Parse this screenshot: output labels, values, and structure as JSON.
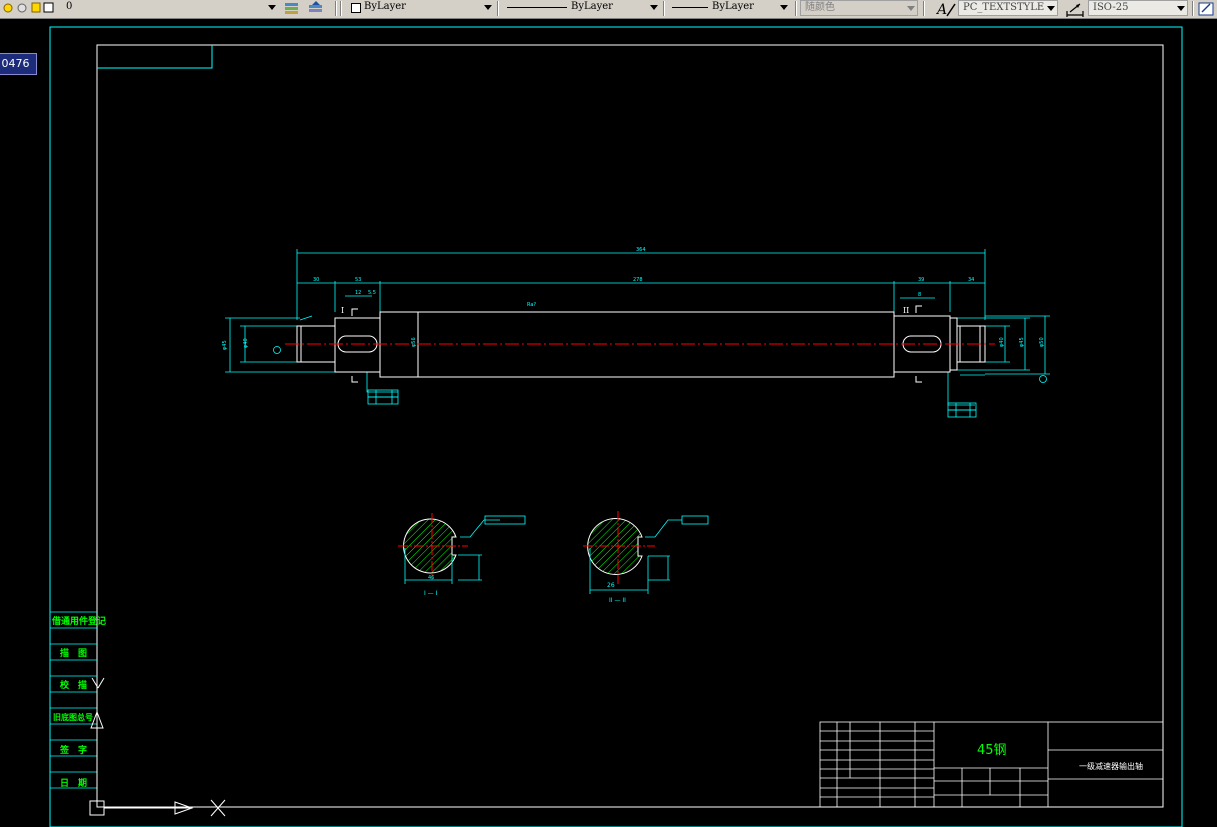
{
  "toolbar": {
    "layer_name": "0",
    "color_control": "ByLayer",
    "linetype_control": "ByLayer",
    "lineweight_control": "ByLayer",
    "plot_style": "随颜色",
    "text_style": "PC_TEXTSTYLE",
    "dim_style": "ISO-25"
  },
  "coord_tooltip": "0476",
  "title_block": {
    "material": "45钢",
    "part_name": "一级减速器输出轴"
  },
  "side_table": {
    "rows": [
      "借通用件登记",
      "描　图",
      "校　描",
      "旧底图总号",
      "签　字",
      "日　期"
    ]
  },
  "sections": {
    "section1_label": "I — I",
    "section2_label": "II — II"
  },
  "colors": {
    "background": "#000000",
    "line": "#ffffff",
    "border": "#00ffff",
    "center": "#ff0000",
    "text": "#00ff00",
    "hatch": "#00ff00"
  }
}
